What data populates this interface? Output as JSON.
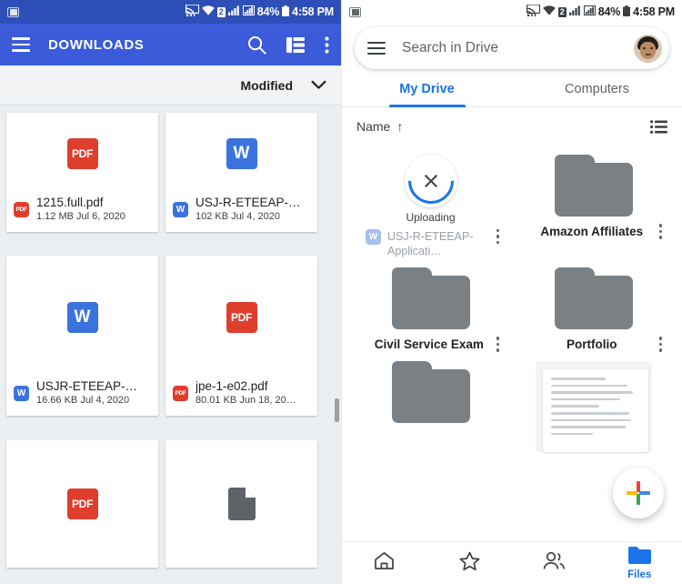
{
  "left": {
    "statusbar": {
      "note_icon": "notification-square-icon",
      "cast_icon": "cast-icon",
      "wifi_icon": "wifi-icon",
      "sim_badge": "2",
      "signal_icon_1": "signal-bars-icon",
      "signal_icon_2": "signal-bars-icon",
      "battery_percent": "84%",
      "battery_icon": "battery-icon",
      "time": "4:58 PM"
    },
    "toolbar": {
      "menu_icon": "hamburger-menu-icon",
      "title": "DOWNLOADS",
      "search_icon": "search-icon",
      "listview_icon": "list-view-icon",
      "overflow_icon": "more-vert-icon",
      "background": "#3b5bdb"
    },
    "sortbar": {
      "label": "Modified",
      "chevron_icon": "chevron-down-icon"
    },
    "files": [
      {
        "name": "1215.full.pdf",
        "size": "1.12 MB",
        "date": "Jul 6, 2020",
        "type": "pdf",
        "badge": "PDF"
      },
      {
        "name": "USJ-R-ETEEAP-…",
        "size": "102 KB",
        "date": "Jul 4, 2020",
        "type": "word",
        "badge": "W"
      },
      {
        "name": "USJR-ETEEAP-…",
        "size": "16.66 KB",
        "date": "Jul 4, 2020",
        "type": "word",
        "badge": "W"
      },
      {
        "name": "jpe-1-e02.pdf",
        "size": "80.01 KB",
        "date": "Jun 18, 20…",
        "type": "pdf",
        "badge": "PDF"
      },
      {
        "name": "",
        "size": "",
        "date": "",
        "type": "pdf",
        "badge": "PDF"
      },
      {
        "name": "",
        "size": "",
        "date": "",
        "type": "generic",
        "badge": ""
      }
    ],
    "scrollbar": "vertical-scrollbar"
  },
  "right": {
    "statusbar": {
      "note_icon": "notification-square-icon",
      "cast_icon": "cast-icon",
      "wifi_icon": "wifi-icon",
      "sim_badge": "2",
      "battery_percent": "84%",
      "battery_icon": "battery-icon",
      "time": "4:58 PM"
    },
    "search": {
      "menu_icon": "hamburger-menu-icon",
      "placeholder": "Search in Drive",
      "avatar": "user-avatar"
    },
    "tabs": [
      {
        "label": "My Drive",
        "active": true
      },
      {
        "label": "Computers",
        "active": false
      }
    ],
    "namebar": {
      "label": "Name",
      "sort_arrow": "↑",
      "listview_icon": "list-view-icon"
    },
    "items": [
      {
        "kind": "uploading",
        "status": "Uploading",
        "name": "USJ-R-ETEEAP-Applicati…",
        "badge": "W"
      },
      {
        "kind": "folder",
        "name": "Amazon Affiliates"
      },
      {
        "kind": "folder",
        "name": "Civil Service Exam"
      },
      {
        "kind": "folder",
        "name": "Portfolio"
      },
      {
        "kind": "folder",
        "name": ""
      },
      {
        "kind": "document",
        "name": ""
      }
    ],
    "fab": {
      "icon": "google-plus-add-icon"
    },
    "bottomnav": [
      {
        "icon": "home-icon",
        "label": "",
        "active": false
      },
      {
        "icon": "star-icon",
        "label": "",
        "active": false
      },
      {
        "icon": "shared-people-icon",
        "label": "",
        "active": false
      },
      {
        "icon": "folder-icon",
        "label": "Files",
        "active": true
      }
    ],
    "accent": "#1a73e8"
  }
}
